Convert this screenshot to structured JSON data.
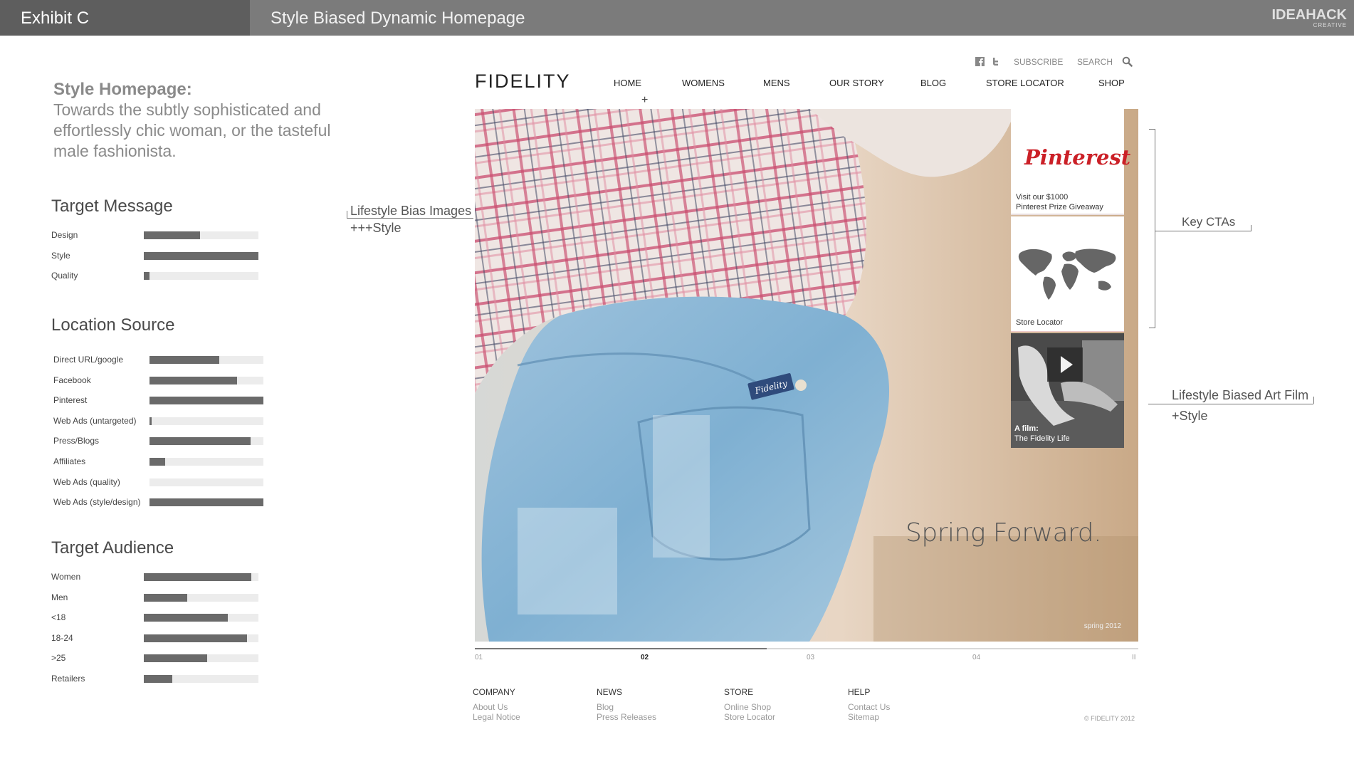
{
  "header": {
    "exhibit": "Exhibit C",
    "title": "Style Biased Dynamic Homepage",
    "brand_line1": "IDEAHACK",
    "brand_line2": "CREATIVE"
  },
  "intro": {
    "heading": "Style Homepage:",
    "body": "Towards the subtly sophisticated and effortlessly chic woman, or the tasteful male fashionista."
  },
  "target_message": {
    "title": "Target Message",
    "items": [
      {
        "label": "Design",
        "value": 0.49
      },
      {
        "label": "Style",
        "value": 1.0
      },
      {
        "label": "Quality",
        "value": 0.05
      }
    ]
  },
  "location_source": {
    "title": "Location Source",
    "items": [
      {
        "label": "Direct URL/google",
        "value": 0.61
      },
      {
        "label": "Facebook",
        "value": 0.77
      },
      {
        "label": "Pinterest",
        "value": 1.0
      },
      {
        "label": "Web Ads (untargeted)",
        "value": 0.02
      },
      {
        "label": "Press/Blogs",
        "value": 0.89
      },
      {
        "label": "Affiliates",
        "value": 0.14
      },
      {
        "label": "Web Ads (quality)",
        "value": 0.0
      },
      {
        "label": "Web Ads (style/design)",
        "value": 1.0
      }
    ]
  },
  "target_audience": {
    "title": "Target Audience",
    "items": [
      {
        "label": "Women",
        "value": 0.94
      },
      {
        "label": "Men",
        "value": 0.38
      },
      {
        "label": "<18",
        "value": 0.73
      },
      {
        "label": "18-24",
        "value": 0.9
      },
      {
        "label": ">25",
        "value": 0.55
      },
      {
        "label": "Retailers",
        "value": 0.25
      }
    ]
  },
  "annotations": {
    "lifestyle_images": "Lifestyle Bias Images",
    "lifestyle_images_sub": "+++Style",
    "key_ctas": "Key CTAs",
    "art_film": "Lifestyle Biased Art Film",
    "art_film_sub": "+Style"
  },
  "site": {
    "logo": "FIDELITY",
    "utility": {
      "facebook_icon": "facebook-icon",
      "twitter_icon": "twitter-icon",
      "subscribe": "SUBSCRIBE",
      "search": "SEARCH",
      "search_icon": "search-icon"
    },
    "nav": [
      "HOME",
      "WOMENS",
      "MENS",
      "OUR STORY",
      "BLOG",
      "STORE LOCATOR",
      "SHOP"
    ],
    "nav_marker": "+",
    "hero": {
      "caption": "Spring Forward.",
      "stamp": "spring 2012",
      "label_patch": "Fidelity"
    },
    "ctas": {
      "pinterest_logo": "Pinterest",
      "pinterest_text_1": "Visit our $1000",
      "pinterest_text_2": "Pinterest Prize Giveaway",
      "store_text": "Store Locator",
      "film_text_1": "A film:",
      "film_text_2": "The Fidelity Life"
    },
    "pager": {
      "slides": [
        "01",
        "02",
        "03",
        "04"
      ],
      "active": "02",
      "pause": "II",
      "progress": 0.44
    },
    "footer": {
      "columns": [
        {
          "title": "COMPANY",
          "links": [
            "About Us",
            "Legal Notice"
          ]
        },
        {
          "title": "NEWS",
          "links": [
            "Blog",
            "Press Releases"
          ]
        },
        {
          "title": "STORE",
          "links": [
            "Online Shop",
            "Store Locator"
          ]
        },
        {
          "title": "HELP",
          "links": [
            "Contact Us",
            "Sitemap"
          ]
        }
      ],
      "copyright": "© FIDELITY 2012"
    }
  }
}
